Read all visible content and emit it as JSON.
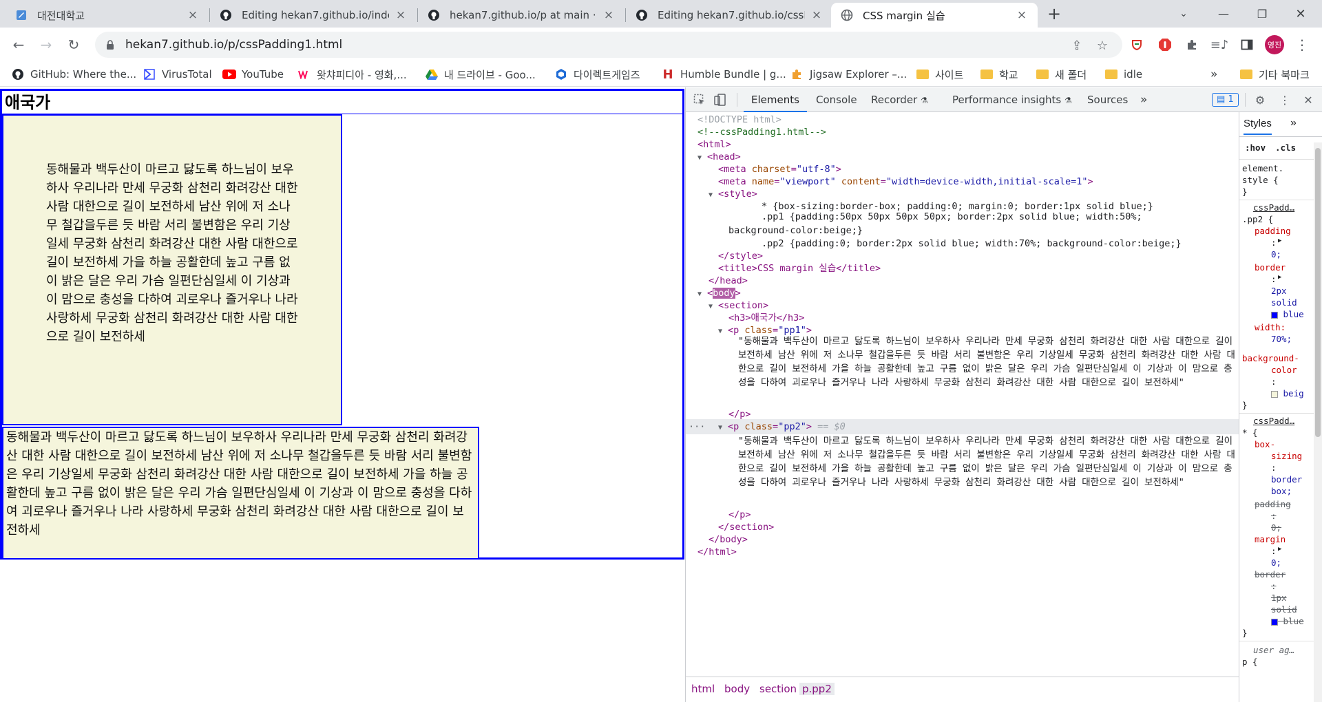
{
  "tabs": [
    {
      "title": "대전대학교",
      "icon": "school-favicon",
      "close": "×"
    },
    {
      "title": "Editing hekan7.github.io/index.h",
      "icon": "github-icon",
      "close": "×"
    },
    {
      "title": "hekan7.github.io/p at main · hek",
      "icon": "github-icon",
      "close": "×"
    },
    {
      "title": "Editing hekan7.github.io/cssPadd",
      "icon": "github-icon",
      "close": "×"
    },
    {
      "title": "CSS margin 실습",
      "icon": "globe-icon",
      "close": "×",
      "active": true
    }
  ],
  "tab_new": "+",
  "toolbar": {
    "url": "hekan7.github.io/p/cssPadding1.html",
    "profile_initials": "영진"
  },
  "bookmarks": [
    {
      "label": "GitHub: Where the...",
      "icon": "github-icon"
    },
    {
      "label": "VirusTotal",
      "icon": "virustotal-icon"
    },
    {
      "label": "YouTube",
      "icon": "youtube-icon"
    },
    {
      "label": "왓챠피디아 - 영화,...",
      "icon": "watcha-icon"
    },
    {
      "label": "내 드라이브 - Goo...",
      "icon": "drive-icon"
    },
    {
      "label": "다이렉트게임즈",
      "icon": "directgames-icon"
    },
    {
      "label": "Humble Bundle | g...",
      "icon": "humble-icon"
    },
    {
      "label": "Jigsaw Explorer –...",
      "icon": "jigsaw-icon"
    },
    {
      "label": "사이트",
      "icon": "folder-icon"
    },
    {
      "label": "학교",
      "icon": "folder-icon"
    },
    {
      "label": "새 폴더",
      "icon": "folder-icon"
    },
    {
      "label": "idle",
      "icon": "folder-icon"
    }
  ],
  "bookmarks_more": "»",
  "bookmarks_other": "기타 북마크",
  "page": {
    "heading": "애국가",
    "pp1": "동해물과 백두산이 마르고 닳도록 하느님이 보우하사 우리나라 만세 무궁화 삼천리 화려강산 대한 사람 대한으로 길이 보전하세 남산 위에 저 소나무 철갑을두른 듯 바람 서리 불변함은 우리 기상일세 무궁화 삼천리 화려강산 대한 사람 대한으로 길이 보전하세 가을 하늘 공활한데 높고 구름 없이 밝은 달은 우리 가슴 일편단심일세 이 기상과 이 맘으로 충성을 다하여 괴로우나 즐거우나 나라 사랑하세 무궁화 삼천리 화려강산 대한 사람 대한으로 길이 보전하세",
    "pp2": "동해물과 백두산이 마르고 닳도록 하느님이 보우하사 우리나라 만세 무궁화 삼천리 화려강산 대한 사람 대한으로 길이 보전하세 남산 위에 저 소나무 철갑을두른 듯 바람 서리 불변함은 우리 기상일세 무궁화 삼천리 화려강산 대한 사람 대한으로 길이 보전하세 가을 하늘 공활한데 높고 구름 없이 밝은 달은 우리 가슴 일편단심일세 이 기상과 이 맘으로 충성을 다하여 괴로우나 즐거우나 나라 사랑하세 무궁화 삼천리 화려강산 대한 사람 대한으로 길이 보전하세"
  },
  "devtools": {
    "tabs": [
      "Elements",
      "Console",
      "Recorder",
      "Performance insights",
      "Sources"
    ],
    "more": "»",
    "issues_count": "1",
    "dom": {
      "doctype": "<!DOCTYPE html>",
      "comment": "<!--cssPadding1.html-->",
      "html_open": "<html>",
      "head_open": "<head>",
      "meta1_tag": "<meta",
      "meta1_attr": "charset",
      "meta1_val": "\"utf-8\"",
      "meta2_tag": "<meta",
      "meta2_attr1": "name",
      "meta2_val1": "\"viewport\"",
      "meta2_attr2": "content",
      "meta2_val2": "\"width=device-width,initial-scale=1\"",
      "style_open": "<style>",
      "css_rule1": "* {box-sizing:border-box; padding:0; margin:0; border:1px solid blue;}",
      "css_rule2": ".pp1 {padding:50px 50px 50px 50px; border:2px solid blue; width:50%; background-color:beige;}",
      "css_rule3": ".pp2 {padding:0; border:2px solid blue; width:70%; background-color:beige;}",
      "style_close": "</style>",
      "title_line": "<title>CSS margin 실습</title>",
      "head_close": "</head>",
      "body_open_pre": "<",
      "body_open_name": "body",
      "body_open_post": ">",
      "section_open": "<section>",
      "h3_line": "<h3>애국가</h3>",
      "p1_tag": "<p",
      "p1_attr": "class",
      "p1_val": "\"pp1\"",
      "p1_text": "\"동해물과 백두산이 마르고 닳도록 하느님이 보우하사 우리나라 만세 무궁화 삼천리 화려강산 대한 사람 대한으로 길이 보전하세 남산 위에 저 소나무 철갑을두른 듯 바람 서리 불변함은 우리 기상일세 무궁화 삼천리 화려강산 대한 사람 대한으로 길이 보전하세 가을 하늘 공활한데 높고 구름 없이 밝은 달은 우리 가슴 일편단심일세 이 기상과 이 맘으로 충성을 다하여 괴로우나 즐거우나 나라 사랑하세 무궁화 삼천리 화려강산 대한 사람 대한으로 길이 보전하세\"",
      "p_close": "</p>",
      "p2_tag": "<p",
      "p2_attr": "class",
      "p2_val": "\"pp2\"",
      "p2_marker": "== $0",
      "p2_text": "\"동해물과 백두산이 마르고 닳도록 하느님이 보우하사 우리나라 만세 무궁화 삼천리 화려강산 대한 사람 대한으로 길이 보전하세 남산 위에 저 소나무 철갑을두른 듯 바람 서리 불변함은 우리 기상일세 무궁화 삼천리 화려강산 대한 사람 대한으로 길이 보전하세 가을 하늘 공활한데 높고 구름 없이 밝은 달은 우리 가슴 일편단심일세 이 기상과 이 맘으로 충성을 다하여 괴로우나 즐거우나 나라 사랑하세 무궁화 삼천리 화려강산 대한 사람 대한으로 길이 보전하세\"",
      "section_close": "</section>",
      "body_close": "</body>",
      "html_close": "</html>"
    },
    "breadcrumbs": [
      "html",
      "body",
      "section",
      "p.pp2"
    ],
    "styles": {
      "title": "Styles",
      "more": "»",
      "hov": ":hov",
      "cls": ".cls",
      "element_style_1": "element.",
      "element_style_2": "style {",
      "close_brace": "}",
      "src1": "cssPadd…",
      "sel1": ".pp2 {",
      "p_padding": "padding",
      "p_colon": ":",
      "v_zero": "0;",
      "p_border": "border",
      "v_2px": "2px",
      "v_solid": "solid",
      "v_blue": "blue",
      "p_width": "width:",
      "v_70": "70%;",
      "p_bg": "background-",
      "p_color": "color",
      "v_beige": "beig",
      "src2": "cssPadd…",
      "sel2": "* {",
      "p_boxsizing1": "box-",
      "p_boxsizing2": "sizing",
      "v_border_a": "border",
      "v_box": "box;",
      "p_margin": "margin",
      "v_1px": "1px",
      "ua": "user ag…",
      "sel3": "p {"
    },
    "colors": {
      "accent": "#1a73e8",
      "tag": "#881280",
      "attr": "#994500",
      "value": "#1a1aa6"
    }
  }
}
